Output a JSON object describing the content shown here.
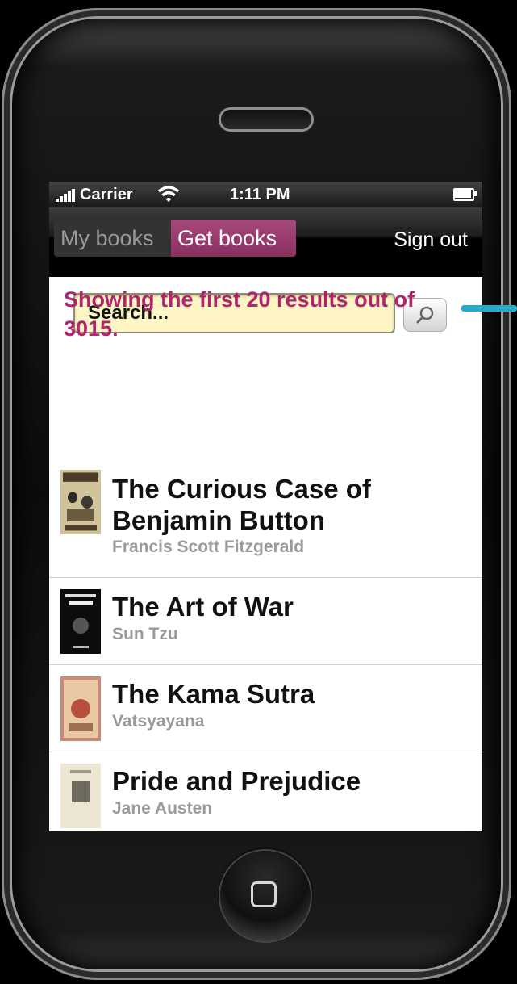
{
  "statusbar": {
    "carrier": "Carrier",
    "time": "1:11 PM",
    "icons": [
      "signal-icon",
      "wifi-icon",
      "battery-icon"
    ]
  },
  "navbar": {
    "tabs": [
      {
        "label": "My books",
        "active": false
      },
      {
        "label": "Get books",
        "active": true
      }
    ],
    "sign_out_label": "Sign out"
  },
  "search": {
    "placeholder": "Search...",
    "button_icon": "search-icon"
  },
  "results_message": "Showing the first 20 results out of 3015.",
  "books": [
    {
      "title": "The Curious Case of Benjamin Button",
      "author": "Francis Scott Fitzgerald"
    },
    {
      "title": "The Art of War",
      "author": "Sun Tzu"
    },
    {
      "title": "The Kama Sutra",
      "author": "Vatsyayana"
    },
    {
      "title": "Pride and Prejudice",
      "author": "Jane Austen"
    }
  ],
  "colors": {
    "accent": "#a54a7b",
    "results_text": "#b0256e",
    "search_bg": "#fdf6c4",
    "annotation_arrow": "#2aa8c8"
  }
}
